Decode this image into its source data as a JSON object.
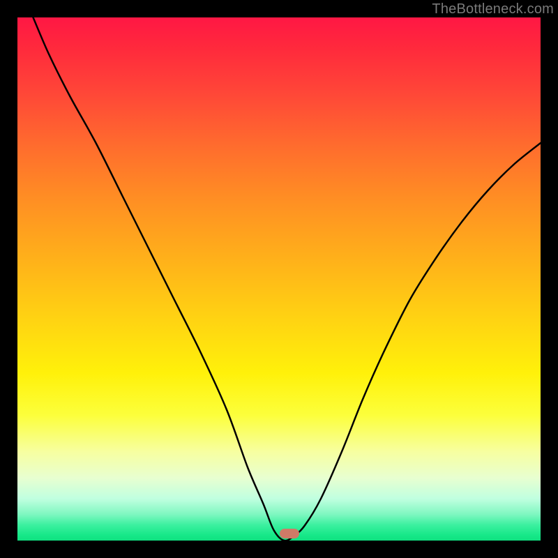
{
  "watermark": "TheBottleneck.com",
  "marker": {
    "x_pct": 52.0,
    "y_pct": 98.7
  },
  "chart_data": {
    "type": "line",
    "title": "",
    "xlabel": "",
    "ylabel": "",
    "xlim": [
      0,
      100
    ],
    "ylim": [
      0,
      100
    ],
    "grid": false,
    "legend": false,
    "series": [
      {
        "name": "bottleneck-curve",
        "x": [
          3,
          6,
          10,
          15,
          20,
          25,
          30,
          35,
          40,
          44,
          47,
          49,
          51,
          53,
          55,
          58,
          62,
          66,
          70,
          75,
          80,
          85,
          90,
          95,
          100
        ],
        "y": [
          100,
          93,
          85,
          76,
          66,
          56,
          46,
          36,
          25,
          14,
          7,
          2,
          0,
          1,
          3,
          8,
          17,
          27,
          36,
          46,
          54,
          61,
          67,
          72,
          76
        ]
      }
    ],
    "annotations": [
      {
        "type": "marker",
        "shape": "pill",
        "color": "#cf7a67",
        "x": 52,
        "y": 1.3
      }
    ],
    "background": {
      "type": "vertical-gradient",
      "stops": [
        {
          "pct": 0,
          "color": "#ff1744"
        },
        {
          "pct": 50,
          "color": "#ffd412"
        },
        {
          "pct": 80,
          "color": "#f7ffa0"
        },
        {
          "pct": 100,
          "color": "#10e080"
        }
      ]
    }
  }
}
